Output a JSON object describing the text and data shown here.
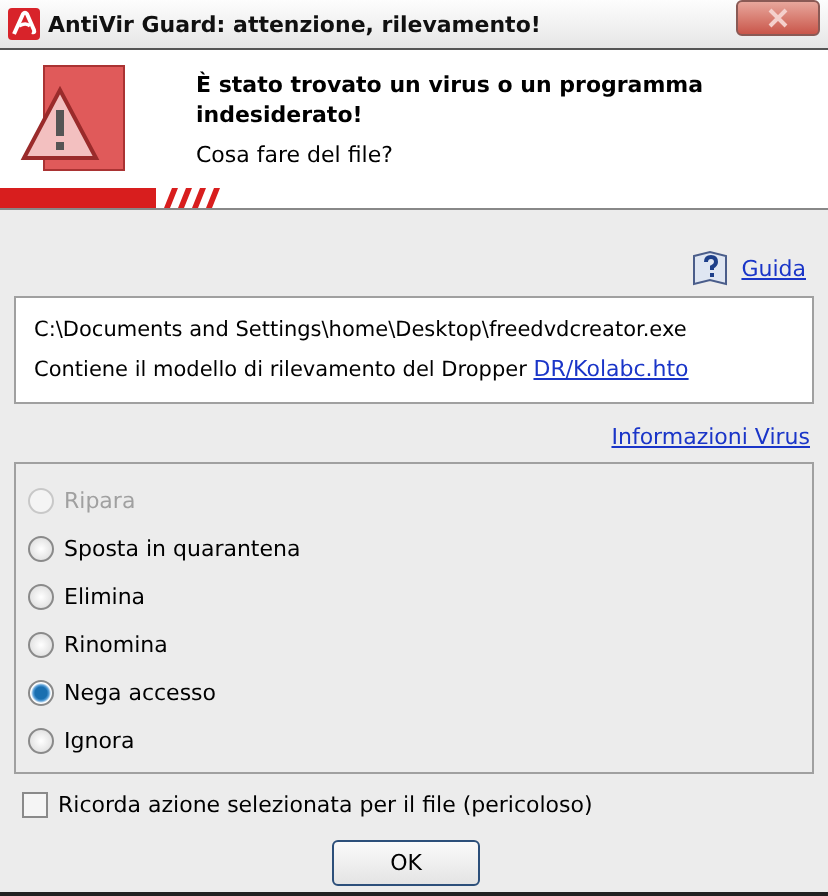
{
  "window": {
    "title": "AntiVir Guard: attenzione, rilevamento!"
  },
  "header": {
    "headline": "È stato trovato un virus o un programma indesiderato!",
    "question": "Cosa fare del file?"
  },
  "help_link": "Guida",
  "detection": {
    "path": "C:\\Documents and Settings\\home\\Desktop\\freedvdcreator.exe",
    "description": "Contiene il modello di rilevamento del Dropper ",
    "threat_link": "DR/Kolabc.hto"
  },
  "virus_info_link": "Informazioni Virus",
  "actions": [
    {
      "label": "Ripara",
      "selected": false,
      "disabled": true
    },
    {
      "label": "Sposta in quarantena",
      "selected": false,
      "disabled": false
    },
    {
      "label": "Elimina",
      "selected": false,
      "disabled": false
    },
    {
      "label": "Rinomina",
      "selected": false,
      "disabled": false
    },
    {
      "label": "Nega accesso",
      "selected": true,
      "disabled": false
    },
    {
      "label": "Ignora",
      "selected": false,
      "disabled": false
    }
  ],
  "remember": {
    "label": "Ricorda azione selezionata per il file (pericoloso)",
    "checked": false
  },
  "ok_button": "OK"
}
